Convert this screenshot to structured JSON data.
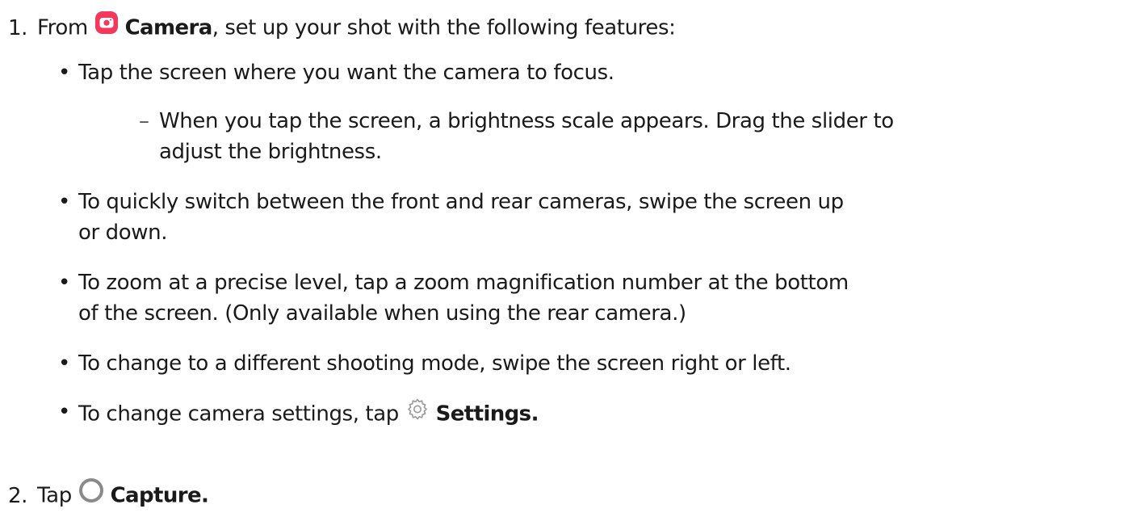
{
  "steps": [
    {
      "number": "1.",
      "prefix": "From",
      "app_icon": "camera-app-icon",
      "app_name": "Camera",
      "suffix": ", set up your shot with the following features:",
      "bullets": [
        {
          "text": "Tap the screen where you want the camera to focus.",
          "sub": "When you tap the screen, a brightness scale appears. Drag the slider to",
          "sub_cont": "adjust the brightness."
        },
        {
          "text": "To quickly switch between the front and rear cameras, swipe the screen up",
          "cont": "or down."
        },
        {
          "text": "To zoom at a precise level, tap a zoom magnification number at the bottom",
          "cont": "of the screen. (Only available when using the rear camera.)"
        },
        {
          "text": "To change to a different shooting mode, swipe the screen right or left."
        },
        {
          "text": "To change camera settings, tap",
          "icon": "gear-icon",
          "label": "Settings",
          "end": "."
        }
      ]
    },
    {
      "number": "2.",
      "prefix": "Tap",
      "icon": "capture-button-icon",
      "label": "Capture",
      "end": "."
    }
  ],
  "colors": {
    "text": "#1a1a1a",
    "camera_icon": "#f4375b",
    "capture_icon": "#8a8a8a",
    "gear_icon": "#9a9a9a"
  }
}
